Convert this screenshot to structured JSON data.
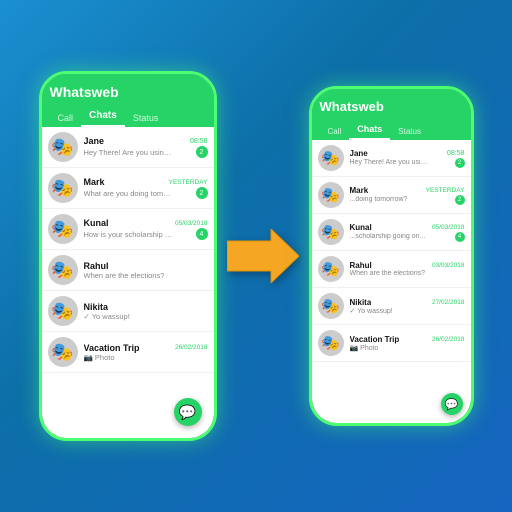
{
  "app": {
    "title": "Whatsweb",
    "tabs": [
      "Call",
      "Chats",
      "Status"
    ],
    "active_tab": "Chats"
  },
  "phone_left": {
    "chats": [
      {
        "name": "Jane",
        "msg": "Hey There! Are you using whatsapp?",
        "time": "08:58",
        "badge": "2",
        "time_class": "green"
      },
      {
        "name": "Mark",
        "msg": "What are you doing tomorrow?",
        "time": "YESTERDAY",
        "badge": "2",
        "time_class": "yesterday"
      },
      {
        "name": "Kunal",
        "msg": "How is your scholarship goin...",
        "time": "05/03/2018",
        "badge": "4",
        "time_class": "date"
      },
      {
        "name": "Rahul",
        "msg": "When are the elections?",
        "time": "",
        "badge": "",
        "time_class": ""
      },
      {
        "name": "Nikita",
        "msg": "✓ Yo wassup!",
        "time": "",
        "badge": "",
        "time_class": ""
      },
      {
        "name": "Vacation Trip",
        "msg": "📷 Photo",
        "time": "26/02/2018",
        "badge": "",
        "time_class": "date"
      }
    ]
  },
  "phone_right": {
    "chats": [
      {
        "name": "Jane",
        "msg": "Hey There! Are you using whatsapp?",
        "time": "08:58",
        "badge": "2",
        "time_class": "green"
      },
      {
        "name": "Mark",
        "msg": "...doing tomorrow?",
        "time": "YESTERDAY",
        "badge": "2",
        "time_class": "yesterday"
      },
      {
        "name": "Kunal",
        "msg": "...scholarship going on...",
        "time": "05/03/2018",
        "badge": "4",
        "time_class": "date"
      },
      {
        "name": "Rahul",
        "msg": "When are the elections?",
        "time": "03/03/2018",
        "badge": "",
        "time_class": "date"
      },
      {
        "name": "Nikita",
        "msg": "✓ Yo wassup!",
        "time": "27/02/2018",
        "badge": "",
        "time_class": "date"
      },
      {
        "name": "Vacation Trip",
        "msg": "📷 Photo",
        "time": "26/02/2018",
        "badge": "",
        "time_class": "date"
      }
    ]
  },
  "fab_icon": "💬",
  "arrow_color": "#f5a623"
}
